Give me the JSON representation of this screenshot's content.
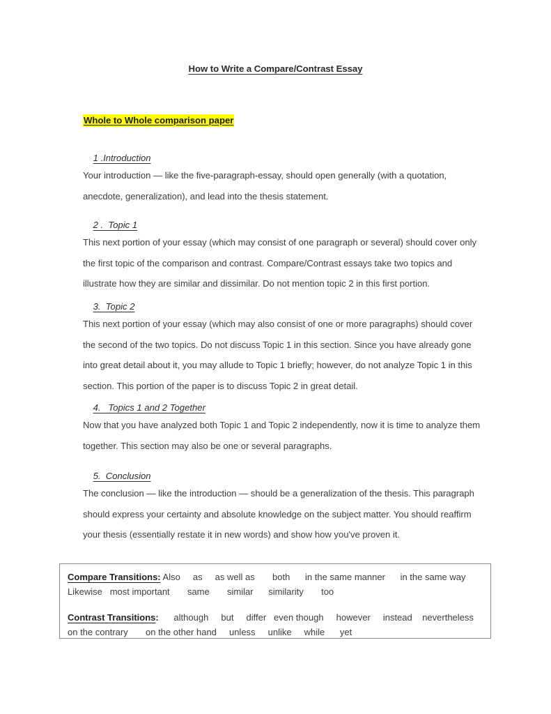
{
  "document": {
    "title": "How to Write a Compare/Contrast Essay",
    "highlighted_heading": "Whole to Whole comparison paper",
    "highlight_color": "#FFFF00",
    "sections": [
      {
        "heading": "1 .Introduction",
        "body": "Your introduction — like the five-paragraph-essay, should open generally (with a quotation, anecdote, generalization), and lead into the thesis statement."
      },
      {
        "heading": "2 .  Topic 1",
        "body": "This next portion of your essay (which may consist of one paragraph or several) should cover only the first topic of the comparison and contrast. Compare/Contrast essays take two topics and illustrate how they are similar and dissimilar. Do not mention topic 2 in this first portion."
      },
      {
        "heading": "3.  Topic 2",
        "body": "This next portion of your essay (which may also consist of one or more paragraphs) should cover the second of the two topics. Do not discuss Topic 1 in this section. Since you have already gone into great detail about it, you may allude to Topic 1 briefly; however, do not analyze Topic 1 in this section. This portion of the paper is to discuss Topic 2 in great detail."
      },
      {
        "heading": "4.   Topics 1 and 2 Together",
        "body": "Now that you have analyzed both Topic 1 and Topic 2 independently, now it is time to analyze them together. This section may also be one or several paragraphs."
      },
      {
        "heading": "5.  Conclusion",
        "body": "The conclusion — like the introduction — should be a generalization of the thesis. This paragraph should express your certainty and absolute knowledge on the subject matter. You should reaffirm your thesis (essentially restate it in new words) and show how you've proven it."
      }
    ]
  },
  "transitions_box": {
    "compare": {
      "label": "Compare Transitions:",
      "line1": " Also     as     as well as       both      in the same manner      in the same way",
      "line2": "Likewise   most important       same       similar      similarity       too"
    },
    "contrast": {
      "label": "Contrast Transitions",
      "label_colon": ":",
      "line1": "      although     but     differ   even though     however     instead    nevertheless",
      "line2": "on the contrary       on the other hand     unless     unlike     while      yet"
    }
  }
}
